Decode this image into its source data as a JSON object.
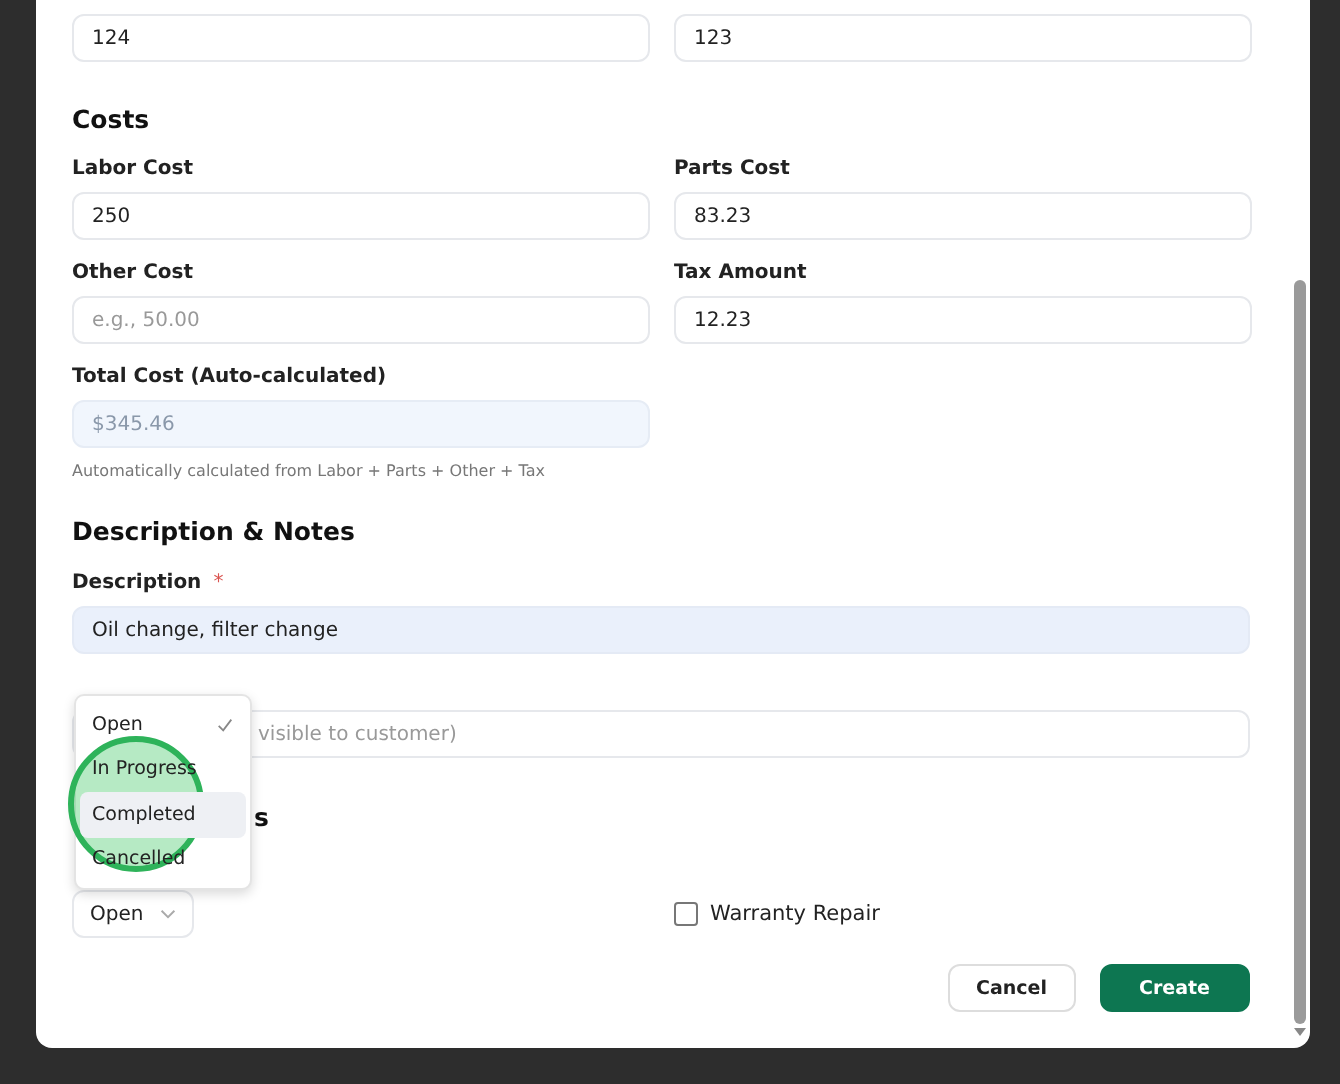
{
  "top_fields": [
    {
      "value": "124"
    },
    {
      "value": "123"
    }
  ],
  "costs": {
    "heading": "Costs",
    "fields": [
      {
        "label": "Labor Cost",
        "value": "250"
      },
      {
        "label": "Parts Cost",
        "value": "83.23"
      },
      {
        "label": "Other Cost",
        "placeholder": "e.g., 50.00"
      },
      {
        "label": "Tax Amount",
        "value": "12.23"
      }
    ],
    "total": {
      "label": "Total Cost (Auto-calculated)",
      "value": "$345.46",
      "hint": "Automatically calculated from Labor + Parts + Other + Tax"
    }
  },
  "description_notes": {
    "heading": "Description & Notes",
    "description": {
      "label": "Description",
      "required_mark": "*",
      "value": "Oil change, filter change"
    },
    "internal_notes": {
      "placeholder": "visible to customer)"
    }
  },
  "section_heading_fragment": "s",
  "status_select": {
    "value": "Open",
    "options": [
      {
        "label": "Open",
        "selected": true,
        "hovered": false
      },
      {
        "label": "In Progress",
        "selected": false,
        "hovered": false
      },
      {
        "label": "Completed",
        "selected": false,
        "hovered": true
      },
      {
        "label": "Cancelled",
        "selected": false,
        "hovered": false
      }
    ]
  },
  "annotation": {
    "kind": "circle"
  },
  "warranty_repair": {
    "label": "Warranty Repair",
    "checked": false
  },
  "buttons": [
    {
      "label": "Cancel",
      "kind": "secondary"
    },
    {
      "label": "Create",
      "kind": "primary"
    }
  ]
}
